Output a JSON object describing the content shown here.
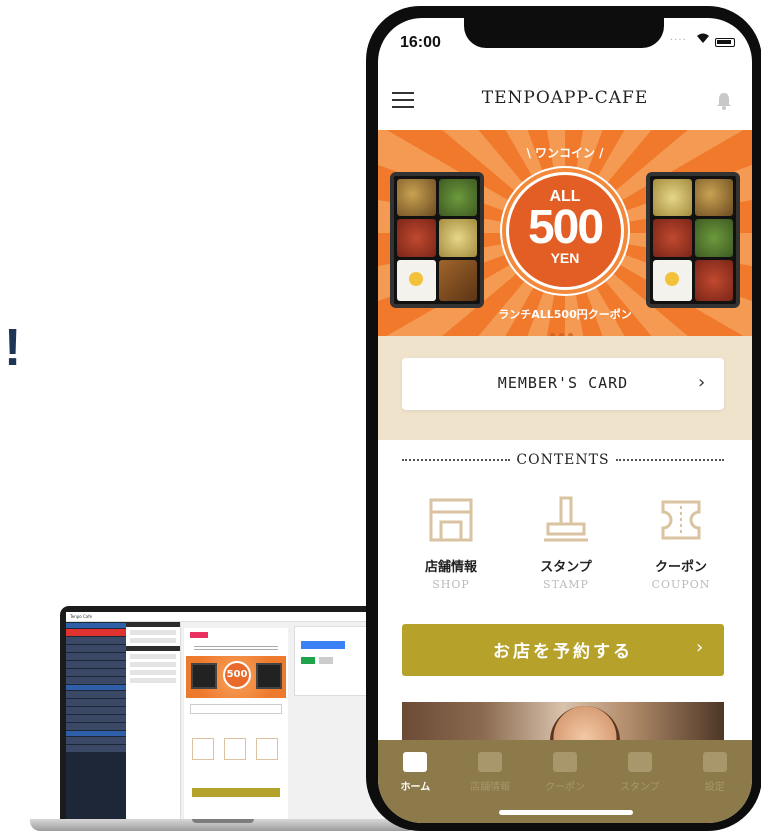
{
  "exclamation": "!",
  "phone": {
    "status": {
      "time": "16:00"
    },
    "header": {
      "title": "TENPOAPP-CAFE"
    },
    "banner": {
      "top_text": "\\ ワンコイン /",
      "badge_all": "ALL",
      "badge_price": "500",
      "badge_unit": "YEN",
      "caption": "ランチALL500円クーポン"
    },
    "member_card": {
      "label": "MEMBER'S CARD"
    },
    "contents": {
      "heading": "CONTENTS",
      "tiles": [
        {
          "label": "店舗情報",
          "sub": "SHOP",
          "icon": "shop-icon"
        },
        {
          "label": "スタンプ",
          "sub": "STAMP",
          "icon": "stamp-icon"
        },
        {
          "label": "クーポン",
          "sub": "COUPON",
          "icon": "coupon-icon"
        }
      ]
    },
    "reserve": {
      "label": "お店を予約する"
    },
    "tabs": [
      {
        "label": "ホーム",
        "active": true
      },
      {
        "label": "店舗情報",
        "active": false
      },
      {
        "label": "クーポン",
        "active": false
      },
      {
        "label": "スタンプ",
        "active": false
      },
      {
        "label": "設定",
        "active": false
      }
    ]
  },
  "laptop": {
    "window_title": "Tenpo Cafe",
    "preview_title": "TENPOAPP-CAFE",
    "preview_price": "500"
  },
  "colors": {
    "accent_gold": "#b6a22a",
    "banner_orange": "#f0792c",
    "tabbar": "#8c7a4b",
    "member_bg": "#efe3cc"
  }
}
